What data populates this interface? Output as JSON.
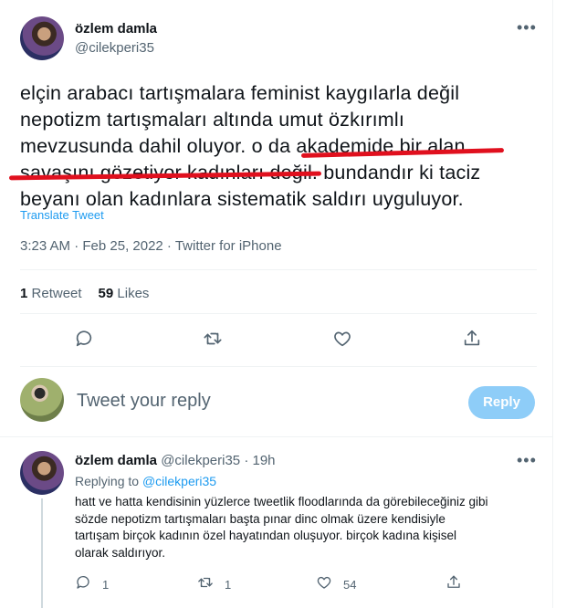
{
  "tweet": {
    "author_name": "özlem damla",
    "author_handle": "@cilekperi35",
    "more_label": "•••",
    "text_lines": [
      "elçin arabacı tartışmalara feminist kaygılarla değil",
      "nepotizm tartışmaları altında umut özkırımlı",
      "mevzusunda dahil oluyor. o da akademide bir alan",
      "savaşını gözetiyor kadınları değil. bundandır ki taciz",
      "beyanı olan kadınlara sistematik saldırı uyguluyor."
    ],
    "translate_label": "Translate Tweet",
    "meta": "3:23 AM · Feb 25, 2022 · Twitter for iPhone",
    "retweet_count": "1",
    "retweet_label": "Retweet",
    "like_count": "59",
    "like_label": "Likes",
    "actions": [
      "reply-icon",
      "retweet-icon",
      "like-icon",
      "share-icon"
    ],
    "highlight_color": "#e0101e"
  },
  "composer": {
    "placeholder": "Tweet your reply",
    "reply_button": "Reply"
  },
  "reply": {
    "author_name": "özlem damla",
    "author_handle": "@cilekperi35",
    "time": "19h",
    "more_label": "•••",
    "replying_prefix": "Replying to",
    "replying_handle": "@cilekperi35",
    "text_lines": [
      "hatt ve hatta kendisinin yüzlerce tweetlik floodlarında da görebileceğiniz gibi",
      "sözde nepotizm tartışmaları başta pınar dinc olmak üzere kendisiyle",
      "tartışam birçok kadının özel hayatından oluşuyor. birçok kadına kişisel",
      "olarak saldırıyor."
    ],
    "reply_count": "1",
    "retweet_count": "1",
    "like_count": "54"
  },
  "colors": {
    "accent": "#1d9bf0",
    "reply_button_disabled": "#8ecdf8",
    "muted_text": "#536471"
  }
}
